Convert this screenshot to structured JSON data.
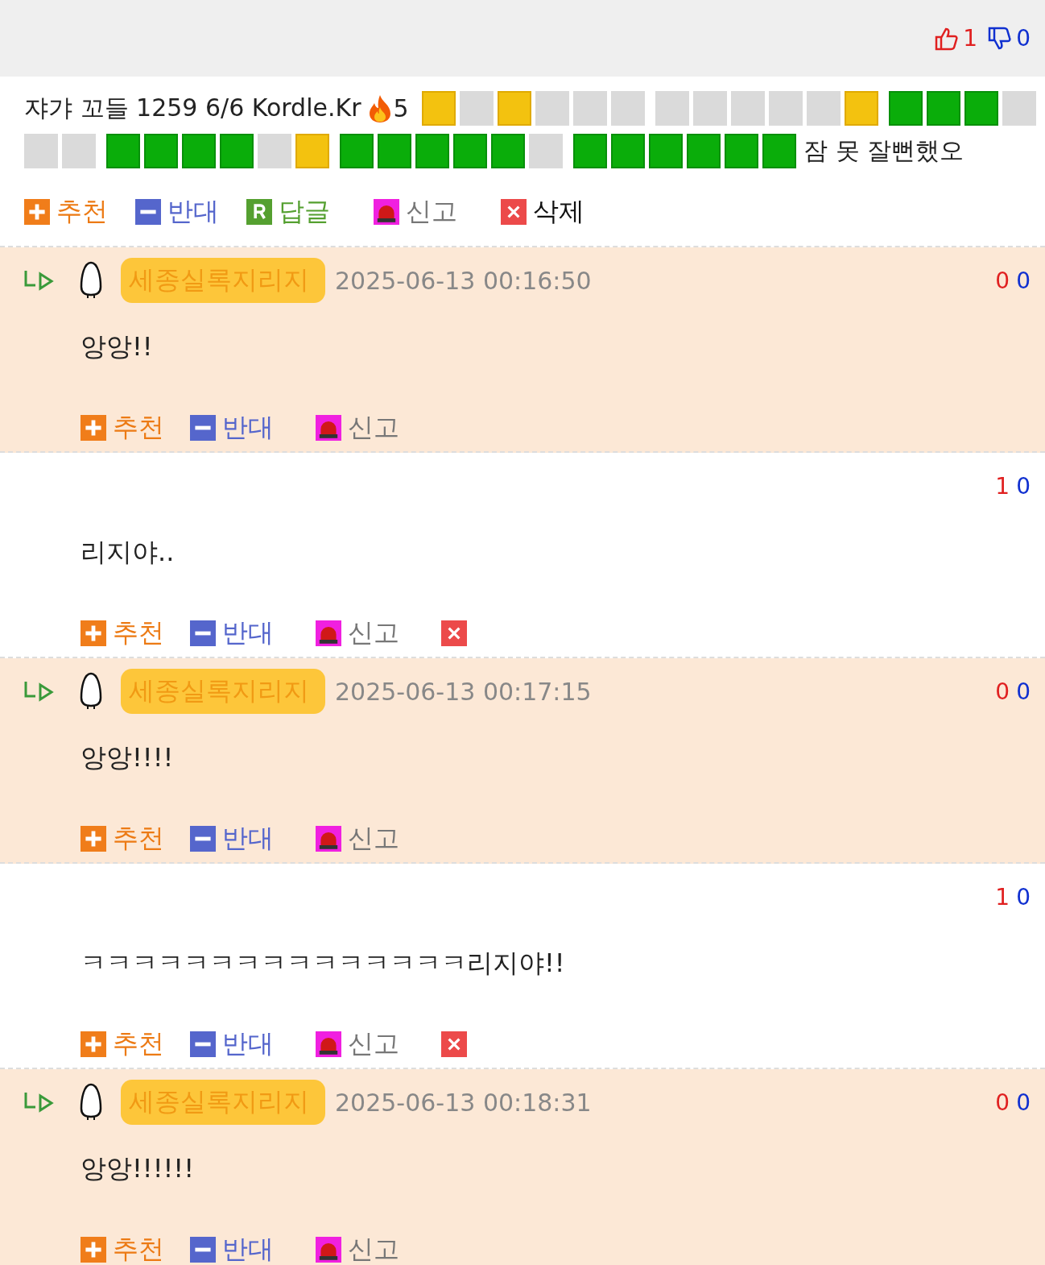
{
  "post_votes": {
    "up": "1",
    "down": "0"
  },
  "result": {
    "text": "쟈갸 꼬들 1259 6/6 Kordle.Kr",
    "streak": "5",
    "comment": "잠 못 잘뻔했오",
    "groups": [
      [
        {
          "kind": "present"
        },
        {
          "kind": "absent"
        },
        {
          "kind": "present"
        },
        {
          "kind": "absent"
        },
        {
          "kind": "absent"
        },
        {
          "kind": "absent"
        }
      ],
      [
        {
          "kind": "absent"
        },
        {
          "kind": "absent"
        },
        {
          "kind": "absent"
        },
        {
          "kind": "absent"
        },
        {
          "kind": "absent"
        },
        {
          "kind": "present"
        }
      ],
      [
        {
          "kind": "correct"
        },
        {
          "kind": "correct"
        },
        {
          "kind": "correct"
        },
        {
          "kind": "absent"
        },
        {
          "kind": "absent"
        },
        {
          "kind": "absent"
        }
      ],
      [
        {
          "kind": "correct"
        },
        {
          "kind": "correct"
        },
        {
          "kind": "correct"
        },
        {
          "kind": "correct"
        },
        {
          "kind": "absent"
        },
        {
          "kind": "present"
        }
      ],
      [
        {
          "kind": "correct"
        },
        {
          "kind": "correct"
        },
        {
          "kind": "correct"
        },
        {
          "kind": "correct"
        },
        {
          "kind": "correct"
        },
        {
          "kind": "absent"
        }
      ],
      [
        {
          "kind": "correct"
        },
        {
          "kind": "correct"
        },
        {
          "kind": "correct"
        },
        {
          "kind": "correct"
        },
        {
          "kind": "correct"
        },
        {
          "kind": "correct"
        }
      ]
    ]
  },
  "post_actions": [
    {
      "kind": "up",
      "label": "추천"
    },
    {
      "kind": "down",
      "label": "반대"
    },
    {
      "kind": "reply",
      "label": "답글"
    },
    {
      "kind": "report",
      "label": "신고"
    },
    {
      "kind": "delete",
      "label": "삭제"
    }
  ],
  "comments": [
    {
      "mine": false,
      "author": {
        "name": "세종실록지리지",
        "highlighted": true
      },
      "time": "2025-06-13 00:16:50",
      "up": "0",
      "down": "0",
      "text": "앙앙!!",
      "actions": [
        {
          "kind": "up",
          "label": "추천"
        },
        {
          "kind": "down",
          "label": "반대"
        },
        {
          "kind": "report",
          "label": "신고"
        }
      ]
    },
    {
      "mine": true,
      "up": "1",
      "down": "0",
      "text": "리지야..",
      "actions": [
        {
          "kind": "up",
          "label": "추천"
        },
        {
          "kind": "down",
          "label": "반대"
        },
        {
          "kind": "report",
          "label": "신고"
        },
        {
          "kind": "delete"
        }
      ]
    },
    {
      "mine": false,
      "author": {
        "name": "세종실록지리지",
        "highlighted": true
      },
      "time": "2025-06-13 00:17:15",
      "up": "0",
      "down": "0",
      "text": "앙앙!!!!",
      "actions": [
        {
          "kind": "up",
          "label": "추천"
        },
        {
          "kind": "down",
          "label": "반대"
        },
        {
          "kind": "report",
          "label": "신고"
        }
      ]
    },
    {
      "mine": true,
      "up": "1",
      "down": "0",
      "text": "ㅋㅋㅋㅋㅋㅋㅋㅋㅋㅋㅋㅋㅋㅋㅋ리지야!!",
      "actions": [
        {
          "kind": "up",
          "label": "추천"
        },
        {
          "kind": "down",
          "label": "반대"
        },
        {
          "kind": "report",
          "label": "신고"
        },
        {
          "kind": "delete"
        }
      ]
    },
    {
      "mine": false,
      "author": {
        "name": "세종실록지리지",
        "highlighted": true
      },
      "time": "2025-06-13 00:18:31",
      "up": "0",
      "down": "0",
      "text": "앙앙!!!!!!",
      "actions": [
        {
          "kind": "up",
          "label": "추천"
        },
        {
          "kind": "down",
          "label": "반대"
        },
        {
          "kind": "report",
          "label": "신고"
        }
      ]
    }
  ]
}
